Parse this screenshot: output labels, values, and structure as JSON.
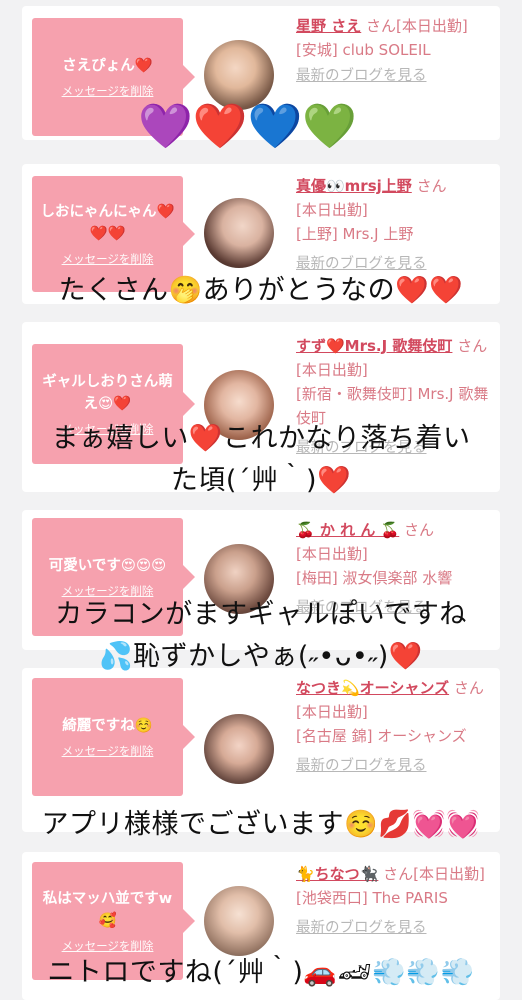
{
  "cards": [
    {
      "message": "さえぴょん❤️",
      "delete_label": "メッセージを削除",
      "name": "星野 さえ",
      "honorific": "さん",
      "status": "[本日出勤]",
      "shop": "[安城] club SOLEIL",
      "blog": "最新のブログを見る"
    },
    {
      "message": "しおにゃんにゃん❤️❤️❤️",
      "delete_label": "メッセージを削除",
      "name": "真優👀mrsj上野",
      "honorific": "さん",
      "status": "[本日出勤]",
      "shop": "[上野] Mrs.J 上野",
      "blog": "最新のブログを見る"
    },
    {
      "message": "ギャルしおりさん萌え😍❤️",
      "delete_label": "メッセージを削除",
      "name": "すず❤️Mrs.J 歌舞伎町",
      "honorific": "さん",
      "status": "[本日出勤]",
      "shop": "[新宿・歌舞伎町] Mrs.J 歌舞伎町",
      "blog": "最新のブログを見る"
    },
    {
      "message": "可愛いです😍😍😍",
      "delete_label": "メッセージを削除",
      "name": "🍒 か れ ん 🍒",
      "honorific": "さん",
      "status": "[本日出勤]",
      "shop": "[梅田] 淑女倶楽部 水響",
      "blog": "最新のブログを見る"
    },
    {
      "message": "綺麗ですね☺️",
      "delete_label": "メッセージを削除",
      "name": "なつき💫オーシャンズ",
      "honorific": "さん",
      "status": "[本日出勤]",
      "shop": "[名古屋 錦] オーシャンズ",
      "blog": "最新のブログを見る"
    },
    {
      "message": "私はマッハ並ですw🥰",
      "delete_label": "メッセージを削除",
      "name": "🐈ちなつ🐈‍⬛",
      "honorific": "さん",
      "status": "[本日出勤]",
      "shop": "[池袋西口] The PARIS",
      "blog": "最新のブログを見る"
    }
  ],
  "overlays": {
    "hearts_row": "💜❤️💙💚",
    "line1": "たくさん🤭ありがとうなの❤️❤️",
    "line2a": "まぁ嬉しい❤️これかなり落ち着い",
    "line2b": "た頃(´艸｀)❤️",
    "line3a": "カラコンがますギャルぽいですね",
    "line3b": "💦恥ずかしやぁ(˶•ᴗ•˶)❤️",
    "line4": "アプリ様様でございます☺️💋💓💓",
    "line5": "ニトロですね(´艸｀)🚗🏎💨💨💨"
  },
  "colors": {
    "bubble": "#f6a1ae",
    "name": "#d2495e",
    "meta": "#d97a86",
    "blog": "#b7b7b7"
  }
}
